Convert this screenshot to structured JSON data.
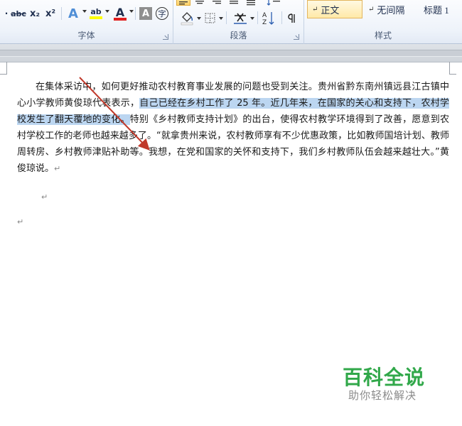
{
  "ribbon": {
    "font_group": {
      "label": "字体",
      "strikethrough": "abc",
      "subscript": "x₂",
      "superscript": "x²",
      "text_effects": "A",
      "highlight": "ab",
      "font_color": "A",
      "char_shading": "A",
      "enclose_char": "字"
    },
    "paragraph_group": {
      "label": "段落"
    },
    "styles_group": {
      "label": "样式",
      "styles": [
        "正文",
        "无间隔",
        "标题 1"
      ],
      "selected": "正文"
    }
  },
  "document": {
    "para_before": "在集体采访中，如何更好推动农村教育事业发展的问题也受到关注。贵州省黔东南州镇远县江古镇中心小学教师黄俊琼代表表示，",
    "para_selected": "自己已经在乡村工作了 25 年。近几年来，在国家的关心和支持下，农村学校发生了翻天覆地的变化。",
    "para_after": "特别《乡村教师支持计划》的出台，使得农村教学环境得到了改善，愿意到农村学校工作的老师也越来越多了。“就拿贵州来说，农村教师享有不少优惠政策，比如教师国培计划、教师周转房、乡村教师津贴补助等。我想，在党和国家的关怀和支持下，我们乡村教师队伍会越来越壮大。”黄俊琼说。",
    "paragraph_mark": "↵"
  },
  "watermark": {
    "title": "百科全说",
    "subtitle": "助你轻松解决"
  },
  "colors": {
    "selection": "#bcd6f1",
    "arrow": "#c0392b",
    "watermark_green": "#31a84a"
  }
}
